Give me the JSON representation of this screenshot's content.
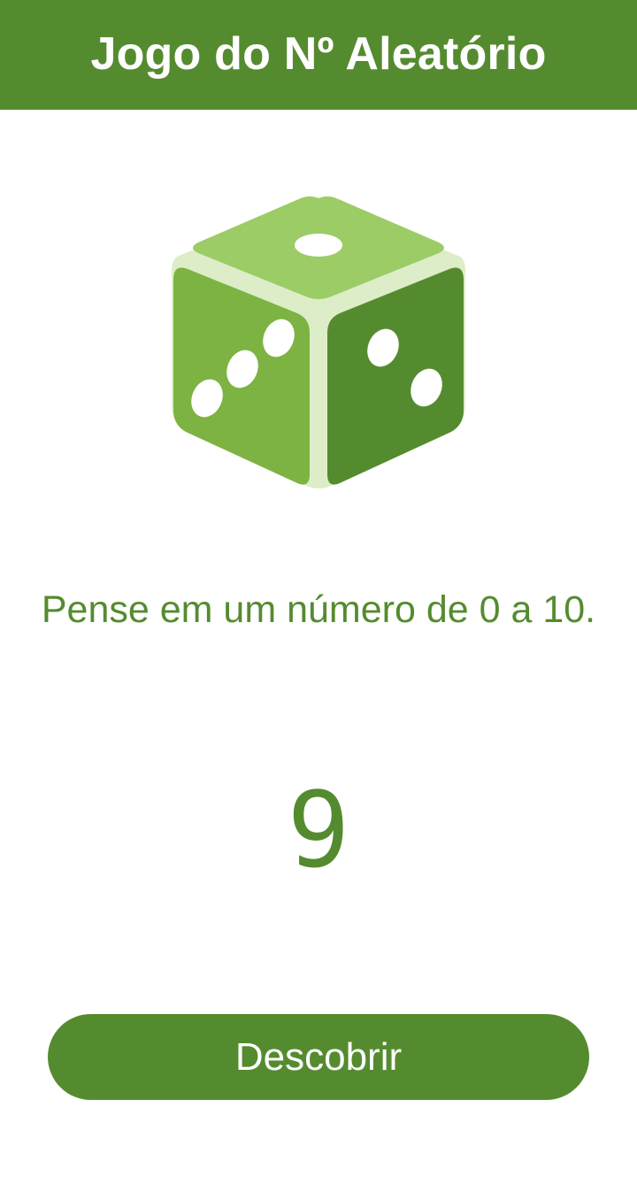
{
  "header": {
    "title": "Jogo do Nº Aleatório",
    "background_color": "#558b2f"
  },
  "dice": {
    "icon": "dice-icon",
    "top_face_pips": 1,
    "left_face_pips": 3,
    "right_face_pips": 2,
    "colors": {
      "top": "#9ccc65",
      "left": "#7cb342",
      "right": "#558b2f",
      "edge": "#dcedc8"
    }
  },
  "main": {
    "prompt": "Pense em um número de 0 a 10.",
    "result_number": "9"
  },
  "actions": {
    "discover_label": "Descobrir"
  },
  "theme": {
    "accent": "#558b2f",
    "text_on_accent": "#ffffff"
  }
}
